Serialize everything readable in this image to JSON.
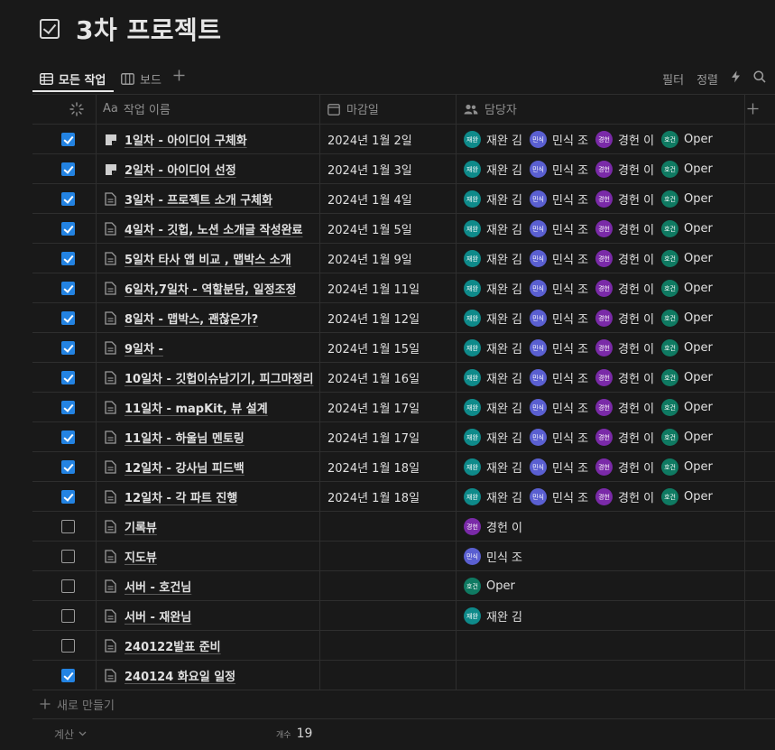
{
  "page": {
    "title": "3차 프로젝트"
  },
  "views": {
    "tabs": [
      {
        "label": "모든 작업",
        "icon": "table-icon",
        "active": true
      },
      {
        "label": "보드",
        "icon": "board-icon",
        "active": false
      }
    ],
    "add_icon": "plus-icon",
    "filter_label": "필터",
    "sort_label": "정렬",
    "automation_icon": "lightning-icon",
    "search_icon": "search-icon"
  },
  "columns": {
    "status_icon": "loading-spinner-icon",
    "name_prefix": "Aa",
    "name": "작업 이름",
    "due": "마감일",
    "assignee": "담당자",
    "add_icon": "plus-icon"
  },
  "colors": {
    "checkbox_on": "#2383e2",
    "avatar_jaewan": "#0e8a8a",
    "avatar_minsik": "#5a5fd1",
    "avatar_kyunghun": "#7a2aa8",
    "avatar_hogun": "#0f7a62"
  },
  "rows": [
    {
      "done": true,
      "icon": "doc-fold-icon",
      "name": "1일차 - 아이디어 구체화",
      "due": "2024년 1월 2일",
      "people": [
        "jaewan",
        "minsik",
        "kyunghun",
        "hogun"
      ]
    },
    {
      "done": true,
      "icon": "doc-fold-icon",
      "name": "2일차 - 아이디어 선정",
      "due": "2024년 1월 3일",
      "people": [
        "jaewan",
        "minsik",
        "kyunghun",
        "hogun"
      ]
    },
    {
      "done": true,
      "icon": "doc-icon",
      "name": "3일차 - 프로젝트 소개 구체화",
      "due": "2024년 1월 4일",
      "people": [
        "jaewan",
        "minsik",
        "kyunghun",
        "hogun"
      ]
    },
    {
      "done": true,
      "icon": "doc-icon",
      "name": "4일차 - 깃헙, 노션 소개글 작성완료",
      "due": "2024년 1월 5일",
      "people": [
        "jaewan",
        "minsik",
        "kyunghun",
        "hogun"
      ]
    },
    {
      "done": true,
      "icon": "doc-icon",
      "name": "5일차 타사 앱 비교 , 맵박스 소개",
      "due": "2024년 1월 9일",
      "people": [
        "jaewan",
        "minsik",
        "kyunghun",
        "hogun"
      ]
    },
    {
      "done": true,
      "icon": "doc-icon",
      "name": "6일차,7일차 - 역할분담, 일정조정",
      "due": "2024년 1월 11일",
      "people": [
        "jaewan",
        "minsik",
        "kyunghun",
        "hogun"
      ]
    },
    {
      "done": true,
      "icon": "doc-icon",
      "name": "8일차 - 맵박스, 괜찮은가?",
      "due": "2024년 1월 12일",
      "people": [
        "jaewan",
        "minsik",
        "kyunghun",
        "hogun"
      ]
    },
    {
      "done": true,
      "icon": "doc-icon",
      "name": "9일차 -",
      "due": "2024년 1월 15일",
      "people": [
        "jaewan",
        "minsik",
        "kyunghun",
        "hogun"
      ]
    },
    {
      "done": true,
      "icon": "doc-icon",
      "name": "10일차 - 깃헙이슈남기기, 피그마정리",
      "due": "2024년 1월 16일",
      "people": [
        "jaewan",
        "minsik",
        "kyunghun",
        "hogun"
      ]
    },
    {
      "done": true,
      "icon": "doc-icon",
      "name": "11일차 - mapKit, 뷰 설계",
      "due": "2024년 1월 17일",
      "people": [
        "jaewan",
        "minsik",
        "kyunghun",
        "hogun"
      ]
    },
    {
      "done": true,
      "icon": "doc-icon",
      "name": "11일차 - 하울님 멘토링",
      "due": "2024년 1월 17일",
      "people": [
        "jaewan",
        "minsik",
        "kyunghun",
        "hogun"
      ]
    },
    {
      "done": true,
      "icon": "doc-icon",
      "name": "12일차 - 강사님 피드백",
      "due": "2024년 1월 18일",
      "people": [
        "jaewan",
        "minsik",
        "kyunghun",
        "hogun"
      ]
    },
    {
      "done": true,
      "icon": "doc-icon",
      "name": "12일차 - 각 파트 진행",
      "due": "2024년 1월 18일",
      "people": [
        "jaewan",
        "minsik",
        "kyunghun",
        "hogun"
      ]
    },
    {
      "done": false,
      "icon": "doc-icon",
      "name": "기록뷰",
      "due": "",
      "people": [
        "kyunghun"
      ]
    },
    {
      "done": false,
      "icon": "doc-icon",
      "name": "지도뷰",
      "due": "",
      "people": [
        "minsik"
      ]
    },
    {
      "done": false,
      "icon": "doc-icon",
      "name": "서버 - 호건님",
      "due": "",
      "people": [
        "hogun"
      ]
    },
    {
      "done": false,
      "icon": "doc-icon",
      "name": "서버 - 재완님",
      "due": "",
      "people": [
        "jaewan"
      ]
    },
    {
      "done": false,
      "icon": "doc-icon",
      "name": "240122발표 준비",
      "due": "",
      "people": []
    },
    {
      "done": true,
      "icon": "doc-icon",
      "name": "240124 화요일 일정",
      "due": "",
      "people": []
    }
  ],
  "persons": {
    "jaewan": {
      "avatar": "재완",
      "name": "재완 김"
    },
    "minsik": {
      "avatar": "민식",
      "name": "민식 조"
    },
    "kyunghun": {
      "avatar": "경헌",
      "name": "경헌 이"
    },
    "hogun": {
      "avatar": "호건",
      "name": "Oper"
    }
  },
  "footer": {
    "new_label": "새로 만들기",
    "calc_label": "계산",
    "count_label": "개수",
    "count_value": "19"
  }
}
